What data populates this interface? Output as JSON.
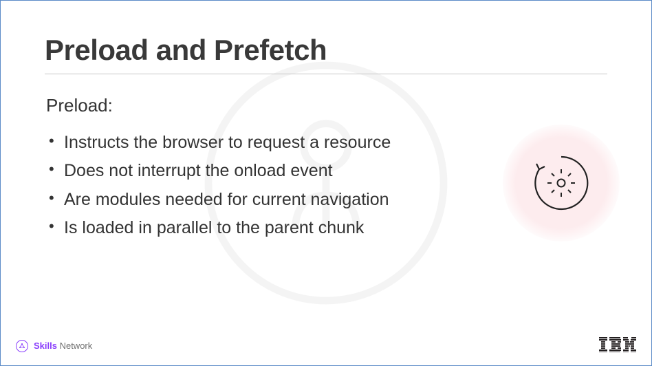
{
  "slide": {
    "title": "Preload and Prefetch",
    "lead": "Preload:",
    "bullets": [
      "Instructs the browser to request a resource",
      "Does not interrupt the onload event",
      "Are modules needed for current navigation",
      "Is loaded in parallel to the parent chunk"
    ]
  },
  "illustration": {
    "name": "refresh-cycle-icon"
  },
  "footer": {
    "skills_bold": "Skills",
    "skills_light": " Network",
    "ibm": "IBM"
  }
}
